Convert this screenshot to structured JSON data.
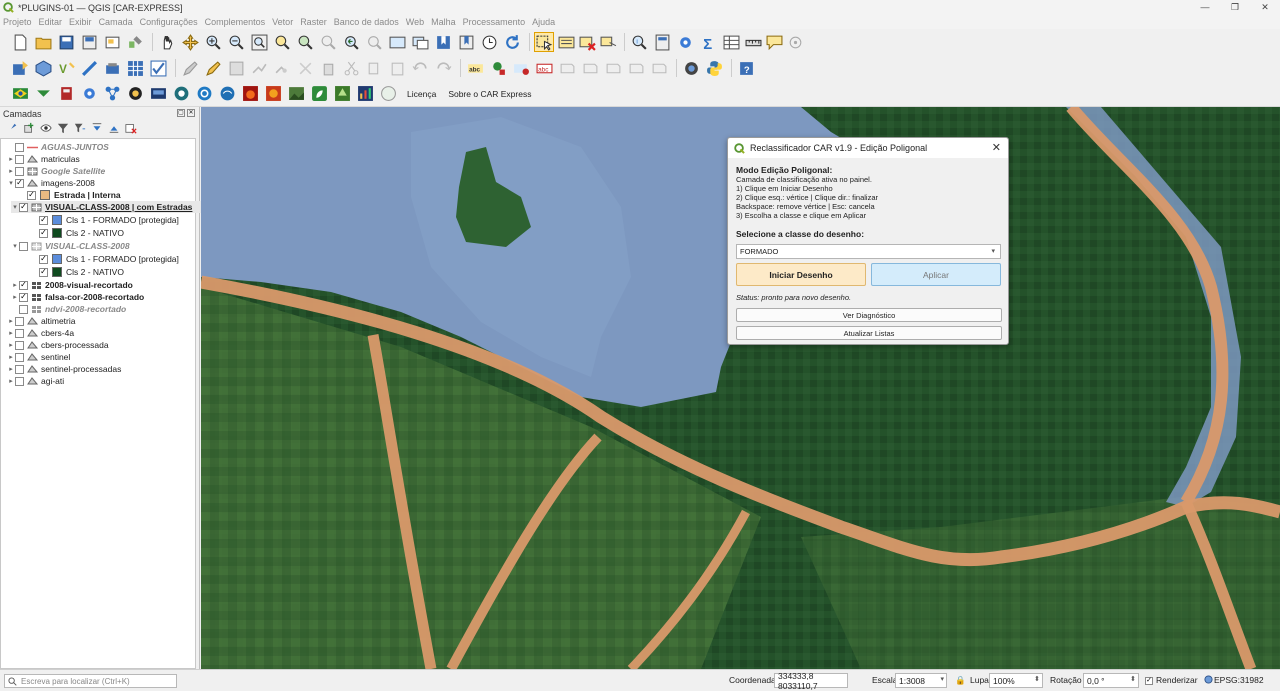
{
  "window": {
    "title": "*PLUGINS-01 — QGIS [CAR-EXPRESS]",
    "controls": [
      "—",
      "❐",
      "✕"
    ]
  },
  "menu": [
    "Projeto",
    "Editar",
    "Exibir",
    "Camada",
    "Configurações",
    "Complementos",
    "Vetor",
    "Raster",
    "Banco de dados",
    "Web",
    "Malha",
    "Processamento",
    "Ajuda"
  ],
  "toolbar3_links": {
    "license": "Licença",
    "about": "Sobre o CAR Express"
  },
  "layers_panel": {
    "title": "Camadas",
    "items": [
      {
        "label": "AGUAS-JUNTOS",
        "checked": false,
        "style": "italic-grey",
        "icon": "line-red-icon",
        "expand": ""
      },
      {
        "label": "matriculas",
        "checked": false,
        "style": "normal",
        "icon": "group-icon",
        "expand": "▸"
      },
      {
        "label": "Google Satellite",
        "checked": false,
        "style": "italic-grey",
        "icon": "raster-icon",
        "expand": "▸"
      },
      {
        "label": "imagens-2008",
        "checked": true,
        "style": "normal",
        "icon": "group-icon",
        "expand": "▾"
      },
      {
        "label": "Estrada | Interna",
        "checked": true,
        "style": "bold",
        "swatch": "#e9b981",
        "expand": ""
      },
      {
        "label": "VISUAL-CLASS-2008 | com Estradas",
        "checked": true,
        "style": "bold-underline",
        "icon": "raster-icon",
        "expand": "▾"
      },
      {
        "label": "Cls 1 - FORMADO [protegida]",
        "checked": true,
        "style": "normal",
        "swatch": "#5b8ddc",
        "expand": ""
      },
      {
        "label": "Cls 2 - NATIVO",
        "checked": true,
        "style": "normal",
        "swatch": "#0f4a1f",
        "expand": ""
      },
      {
        "label": "VISUAL-CLASS-2008",
        "checked": false,
        "style": "italic-grey",
        "icon": "raster-icon",
        "expand": "▾"
      },
      {
        "label": "Cls 1 - FORMADO [protegida]",
        "checked": true,
        "style": "normal",
        "swatch": "#5b8ddc",
        "expand": ""
      },
      {
        "label": "Cls 2 - NATIVO",
        "checked": true,
        "style": "normal",
        "swatch": "#0f4a1f",
        "expand": ""
      },
      {
        "label": "2008-visual-recortado",
        "checked": true,
        "style": "bold",
        "icon": "raster-icon",
        "expand": "▸"
      },
      {
        "label": "falsa-cor-2008-recortado",
        "checked": true,
        "style": "bold",
        "icon": "raster-icon",
        "expand": "▸"
      },
      {
        "label": "ndvi-2008-recortado",
        "checked": false,
        "style": "italic-grey",
        "icon": "raster-icon",
        "expand": ""
      },
      {
        "label": "altimetria",
        "checked": false,
        "style": "normal",
        "icon": "group-icon",
        "expand": "▸"
      },
      {
        "label": "cbers-4a",
        "checked": false,
        "style": "normal",
        "icon": "group-icon",
        "expand": "▸"
      },
      {
        "label": "cbers-processada",
        "checked": false,
        "style": "normal",
        "icon": "group-icon",
        "expand": "▸"
      },
      {
        "label": "sentinel",
        "checked": false,
        "style": "normal",
        "icon": "group-icon",
        "expand": "▸"
      },
      {
        "label": "sentinel-processadas",
        "checked": false,
        "style": "normal",
        "icon": "group-icon",
        "expand": "▸"
      },
      {
        "label": "agi-ati",
        "checked": false,
        "style": "normal",
        "icon": "group-icon",
        "expand": "▸"
      }
    ]
  },
  "dialog": {
    "title": "Reclassificador CAR v1.9 - Edição Poligonal",
    "mode_title": "Modo Edição Poligonal:",
    "instructions": [
      "Camada de classificação ativa no painel.",
      "1) Clique em Iniciar Desenho",
      "2) Clique esq.: vértice | Clique dir.: finalizar",
      "   Backspace: remove vértice | Esc: cancela",
      "3) Escolha a classe e clique em Aplicar"
    ],
    "select_label": "Selecione a classe do desenho:",
    "select_value": "FORMADO",
    "start_button": "Iniciar Desenho",
    "apply_button": "Aplicar",
    "status": "Status: pronto para novo desenho.",
    "diag_button": "Ver Diagnóstico",
    "refresh_button": "Atualizar Listas"
  },
  "statusbar": {
    "locator_placeholder": "Escreva para localizar (Ctrl+K)",
    "coord_label": "Coordenada",
    "coord_value": "334333,8  8033110,7",
    "scale_label": "Escala",
    "scale_value": "1:3008",
    "magnifier_label": "Lupa",
    "magnifier_value": "100%",
    "rotation_label": "Rotação",
    "rotation_value": "0,0 °",
    "render_label": "Renderizar",
    "crs": "EPSG:31982"
  },
  "colors": {
    "road": "#d9996a",
    "water": "#7d98c0",
    "forest": "#24522a",
    "start_button_bg": "#fdeac8",
    "apply_button_bg": "#d4ecfb"
  }
}
